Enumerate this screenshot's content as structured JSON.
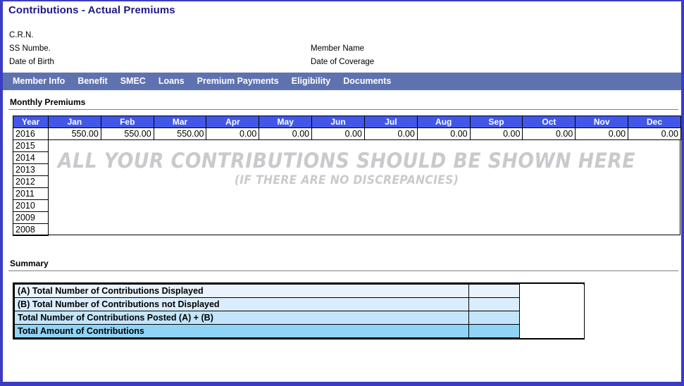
{
  "page": {
    "title": "Contributions - Actual Premiums",
    "accent_border": "#3b3bc4",
    "title_color": "#1a1a8c"
  },
  "member_header": {
    "left": [
      {
        "label": "C.R.N."
      },
      {
        "label": "SS Numbe."
      },
      {
        "label": "Date of Birth"
      }
    ],
    "right": [
      {
        "label": "Member Name"
      },
      {
        "label": "Date of Coverage"
      }
    ]
  },
  "nav": {
    "background": "#5f72b0",
    "items": [
      {
        "label": "Member Info"
      },
      {
        "label": "Benefit"
      },
      {
        "label": "SMEC"
      },
      {
        "label": "Loans"
      },
      {
        "label": "Premium Payments"
      },
      {
        "label": "Eligibility"
      },
      {
        "label": "Documents"
      }
    ]
  },
  "monthly_premiums": {
    "heading": "Monthly Premiums",
    "header_background": "#4257e8",
    "columns": [
      "Year",
      "Jan",
      "Feb",
      "Mar",
      "Apr",
      "May",
      "Jun",
      "Jul",
      "Aug",
      "Sep",
      "Oct",
      "Nov",
      "Dec"
    ],
    "rows": [
      {
        "year": "2016",
        "values": [
          "550.00",
          "550.00",
          "550.00",
          "0.00",
          "0.00",
          "0.00",
          "0.00",
          "0.00",
          "0.00",
          "0.00",
          "0.00",
          "0.00"
        ]
      },
      {
        "year": "2015",
        "values": [
          "",
          "",
          "",
          "",
          "",
          "",
          "",
          "",
          "",
          "",
          "",
          ""
        ]
      },
      {
        "year": "2014",
        "values": [
          "",
          "",
          "",
          "",
          "",
          "",
          "",
          "",
          "",
          "",
          "",
          ""
        ]
      },
      {
        "year": "2013",
        "values": [
          "",
          "",
          "",
          "",
          "",
          "",
          "",
          "",
          "",
          "",
          "",
          ""
        ]
      },
      {
        "year": "2012",
        "values": [
          "",
          "",
          "",
          "",
          "",
          "",
          "",
          "",
          "",
          "",
          "",
          ""
        ]
      },
      {
        "year": "2011",
        "values": [
          "",
          "",
          "",
          "",
          "",
          "",
          "",
          "",
          "",
          "",
          "",
          ""
        ]
      },
      {
        "year": "2010",
        "values": [
          "",
          "",
          "",
          "",
          "",
          "",
          "",
          "",
          "",
          "",
          "",
          ""
        ]
      },
      {
        "year": "2009",
        "values": [
          "",
          "",
          "",
          "",
          "",
          "",
          "",
          "",
          "",
          "",
          "",
          ""
        ]
      },
      {
        "year": "2008",
        "values": [
          "",
          "",
          "",
          "",
          "",
          "",
          "",
          "",
          "",
          "",
          "",
          ""
        ]
      }
    ],
    "watermark": {
      "line1": "ALL YOUR CONTRIBUTIONS SHOULD BE SHOWN HERE",
      "line2": "(IF THERE ARE NO DISCREPANCIES)",
      "color": "#c9cacd"
    }
  },
  "summary": {
    "heading": "Summary",
    "rows": [
      {
        "label": "(A) Total Number of Contributions Displayed",
        "value": "",
        "row_color": "#eaf3fd"
      },
      {
        "label": "(B) Total Number of Contributions not Displayed",
        "value": "",
        "row_color": "#daedfc"
      },
      {
        "label": "Total Number of Contributions Posted (A) + (B)",
        "value": "",
        "row_color": "#c3e5fb"
      },
      {
        "label": "Total Amount of Contributions",
        "value": "",
        "row_color": "#8fd4f7"
      }
    ]
  }
}
